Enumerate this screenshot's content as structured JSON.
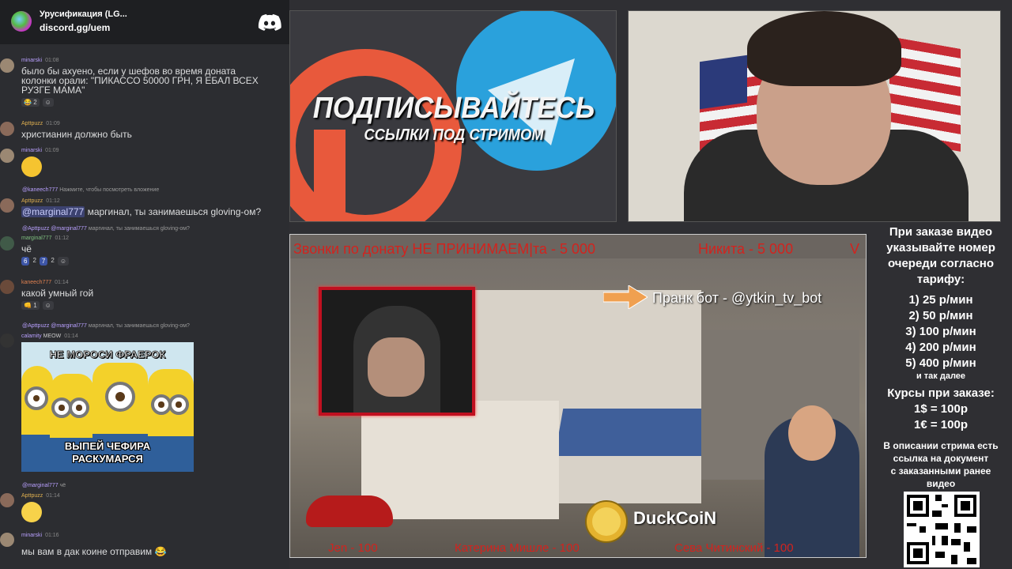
{
  "discord": {
    "server_name": "Урусификация (LG...",
    "invite": "discord.gg/uem",
    "messages": [
      {
        "author": "minarski",
        "time": "01:08",
        "text_line1": "было бы ахуено, если у шефов во время доната",
        "text_line2": "колонки орали: \"ПИКАССО 50000 ГРН, Я ЕБАЛ ВСЕХ",
        "text_line3": "РУЗГЕ МАМА\"",
        "reaction_count": "2"
      },
      {
        "author": "Apttpuzz",
        "time": "01:09",
        "text": "христианин должно быть"
      },
      {
        "author": "minarski",
        "time": "01:09"
      },
      {
        "reply_author": "@kaneech777",
        "reply_text": "Нажмите, чтобы посмотреть вложение",
        "author": "Apttpuzz",
        "time": "01:12",
        "mention": "@marginal777",
        "text": "маргинал, ты занимаешься gloving-ом?"
      },
      {
        "reply_author": "@Apttpuzz",
        "reply_mention": "@marginal777",
        "reply_text": "маргинал, ты занимаешься gloving-ом?",
        "author": "marginal777",
        "time": "01:12",
        "text": "чё",
        "reactions": [
          "6",
          "2",
          "7",
          "2"
        ]
      },
      {
        "author": "kaneech777",
        "time": "01:14",
        "text": "какой умный гой",
        "reaction_count": "1"
      },
      {
        "reply_author": "@Apttpuzz",
        "reply_mention": "@marginal777",
        "reply_text": "маргинал, ты занимаешься gloving-ом?",
        "author": "calamity",
        "badge": "MEOW",
        "time": "01:14"
      },
      {
        "reply_author": "@marginal777",
        "reply_text": "чё",
        "author": "Apttpuzz",
        "time": "01:14"
      },
      {
        "author": "minarski",
        "time": "01:16",
        "text": "мы вам в дак коине отправим"
      }
    ],
    "meme": {
      "top": "НЕ МОРОСИ ФРАЕРОК",
      "bottom_line1": "ВЫПЕЙ ЧЕФИРА",
      "bottom_line2": "РАСКУМАРСЯ"
    }
  },
  "telegram_banner": {
    "line1": "ПОДПИСЫВАЙТЕСЬ",
    "line2": "ССЫЛКИ ПОД СТРИМОМ"
  },
  "stream": {
    "ticker_a": "Звонки по донату НЕ ПРИНИМАЕМ|та - 5 000",
    "ticker_b": "Никита - 5 000",
    "ticker_c": "V",
    "prank_label": "Пранк бот - @ytkin_tv_bot",
    "duckcoin": "DuckCoiN",
    "bottom": [
      "Jen - 100",
      "Катерина Мишле - 100",
      "Сева Читинский - 100"
    ]
  },
  "info": {
    "header_lines": [
      "При заказе видео",
      "указывайте номер",
      "очереди согласно",
      "тарифу:"
    ],
    "tariffs": [
      "1) 25 р/мин",
      "2) 50 р/мин",
      "3) 100 р/мин",
      "4) 200 р/мин",
      "5) 400 р/мин"
    ],
    "tariff_more": "и так далее",
    "rates_title": "Курсы при заказе:",
    "rates": [
      "1$ = 100р",
      "1€ = 100р"
    ],
    "desc_lines": [
      "В описании стрима есть",
      "ссылка на документ",
      "с заказанными ранее",
      "видео"
    ]
  },
  "colors": {
    "discord_bg": "#2c2d31",
    "ticker_red": "#d2231e",
    "mention_blue": "#3c4270",
    "telegram_blue": "#2aa1dc",
    "patreon_orange": "#e8593c"
  }
}
